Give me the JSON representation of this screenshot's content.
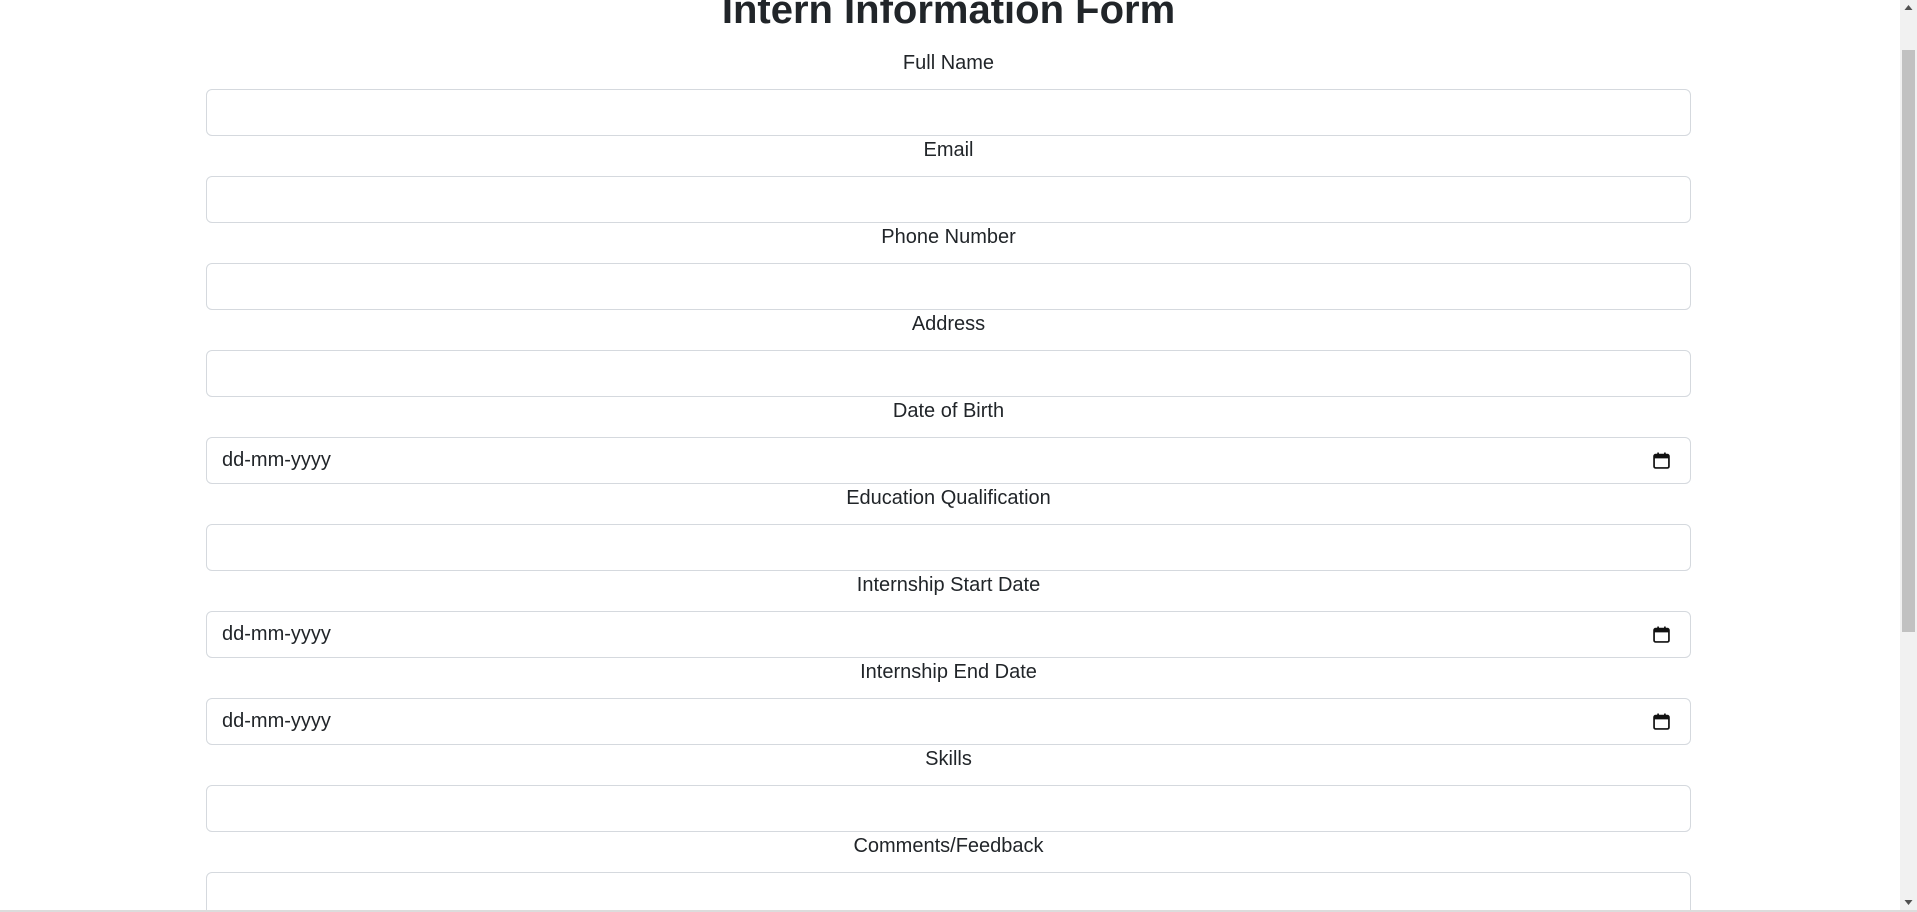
{
  "form": {
    "title": "Intern Information Form",
    "fields": [
      {
        "label": "Full Name",
        "type": "text",
        "value": ""
      },
      {
        "label": "Email",
        "type": "text",
        "value": ""
      },
      {
        "label": "Phone Number",
        "type": "text",
        "value": ""
      },
      {
        "label": "Address",
        "type": "text",
        "value": ""
      },
      {
        "label": "Date of Birth",
        "type": "date",
        "placeholder": "dd-mm-yyyy"
      },
      {
        "label": "Education Qualification",
        "type": "text",
        "value": ""
      },
      {
        "label": "Internship Start Date",
        "type": "date",
        "placeholder": "dd-mm-yyyy"
      },
      {
        "label": "Internship End Date",
        "type": "date",
        "placeholder": "dd-mm-yyyy"
      },
      {
        "label": "Skills",
        "type": "text",
        "value": ""
      },
      {
        "label": "Comments/Feedback",
        "type": "textarea",
        "value": ""
      }
    ]
  },
  "icons": {
    "date_picker": "calendar-icon",
    "scroll_up": "scroll-up-arrow-icon",
    "scroll_down": "scroll-down-arrow-icon"
  },
  "colors": {
    "text": "#212529",
    "input_border": "#d5d9de",
    "scrollbar_track": "#f1f1f1",
    "scrollbar_thumb": "#c1c1c1"
  }
}
